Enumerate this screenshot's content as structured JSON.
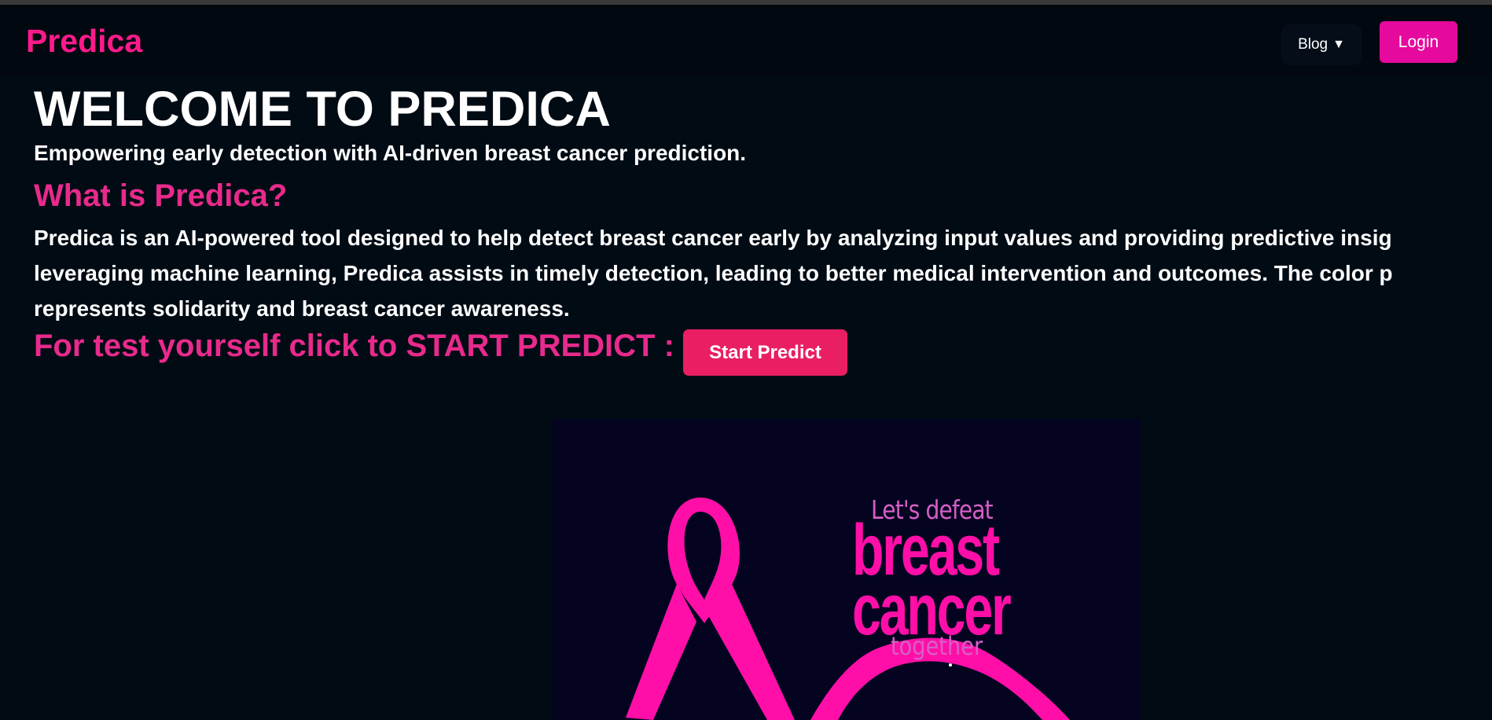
{
  "navbar": {
    "brand": "Predica",
    "blog_label": "Blog",
    "blog_caret": "▼",
    "login_label": "Login"
  },
  "hero": {
    "title": "WELCOME TO PREDICA",
    "subtitle": "Empowering early detection with AI-driven breast cancer prediction."
  },
  "about": {
    "heading": "What is Predica?",
    "lines": [
      "Predica is an AI-powered tool designed to help detect breast cancer early by analyzing input values and providing predictive insig",
      "leveraging machine learning, Predica assists in timely detection, leading to better medical intervention and outcomes. The color p",
      "represents solidarity and breast cancer awareness."
    ]
  },
  "cta": {
    "text": "For test yourself click to START PREDICT :",
    "button_label": "Start Predict"
  },
  "poster": {
    "line1": "Let's defeat",
    "line2": "breast",
    "line3": "cancer",
    "line4": "together",
    "ribbon_icon": "awareness-ribbon-icon"
  },
  "colors": {
    "background": "#010b14",
    "brand_pink": "#ff1a8c",
    "heading_pink": "#e82a8c",
    "login_bg": "#e6099d",
    "start_bg": "#e91e63",
    "ribbon_pink": "#ff0fa8"
  }
}
